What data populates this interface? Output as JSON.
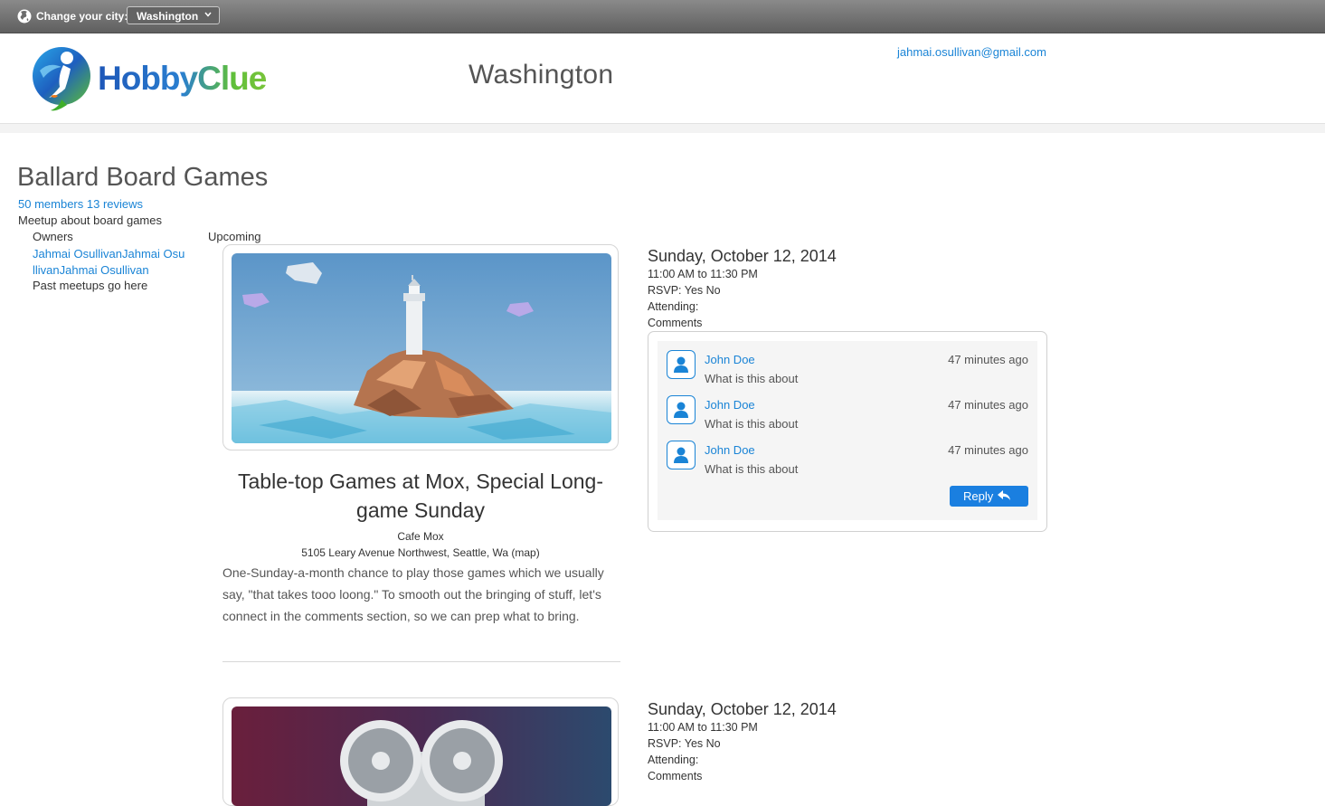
{
  "topbar": {
    "change_city_label": "Change your city:",
    "selected_city": "Washington",
    "icons": [
      "globe-icon",
      "chevron-down-icon"
    ]
  },
  "header": {
    "logo_text": "HobbyClue",
    "city": "Washington",
    "user_email": "jahmai.osullivan@gmail.com"
  },
  "group": {
    "title": "Ballard Board Games",
    "members": "50 members",
    "reviews": "13 reviews",
    "description": "Meetup about board games",
    "owners_label": "Owners",
    "owners_link": "Jahmai OsullivanJahmai OsullivanJahmai Osullivan",
    "past_meetups": "Past meetups go here",
    "upcoming_label": "Upcoming"
  },
  "events": [
    {
      "title": "Table-top Games at Mox, Special Long-game Sunday",
      "venue": "Cafe Mox",
      "address": "5105 Leary Avenue Northwest, Seattle, Wa (map)",
      "description": "One-Sunday-a-month chance to play those games which we usually say, \"that takes tooo loong.\" To smooth out the bringing of stuff, let's connect in the comments section, so we can prep what to bring.",
      "date": "Sunday, October 12, 2014",
      "time": "11:00 AM to 11:30 PM",
      "rsvp": "RSVP: Yes No",
      "attending": "Attending:",
      "comments_label": "Comments",
      "comments": [
        {
          "author": "John Doe",
          "text": "What is this about",
          "time": "47 minutes ago"
        },
        {
          "author": "John Doe",
          "text": "What is this about",
          "time": "47 minutes ago"
        },
        {
          "author": "John Doe",
          "text": "What is this about",
          "time": "47 minutes ago"
        }
      ],
      "reply_label": "Reply"
    },
    {
      "date": "Sunday, October 12, 2014",
      "time": "11:00 AM to 11:30 PM",
      "rsvp": "RSVP: Yes No",
      "attending": "Attending:",
      "comments_label": "Comments"
    }
  ],
  "colors": {
    "link": "#1a84d6",
    "button": "#1a7fe0",
    "topbar": "#6e6e6e"
  }
}
